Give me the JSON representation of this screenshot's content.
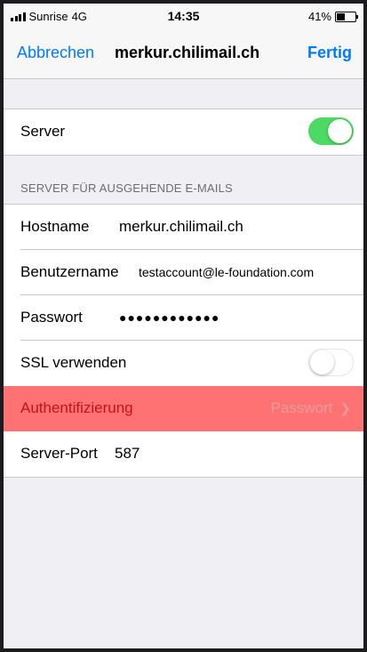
{
  "status_bar": {
    "carrier": "Sunrise",
    "network": "4G",
    "time": "14:35",
    "battery": "41%",
    "battery_level": 0.41
  },
  "nav": {
    "cancel_label": "Abbrechen",
    "title": "merkur.chilimail.ch",
    "done_label": "Fertig"
  },
  "server_row": {
    "label": "Server",
    "toggle_on": true
  },
  "outgoing_section": {
    "header": "SERVER FÜR AUSGEHENDE E-MAILS",
    "hostname": {
      "label": "Hostname",
      "value": "merkur.chilimail.ch"
    },
    "username": {
      "label": "Benutzername",
      "value": "testaccount@le-foundation.com"
    },
    "password": {
      "label": "Passwort",
      "value": "●●●●●●●●●●●●"
    },
    "ssl": {
      "label": "SSL verwenden",
      "toggle_on": false
    },
    "auth": {
      "label": "Authentifizierung",
      "value": "Passwort"
    },
    "port": {
      "label": "Server-Port",
      "value": "587"
    }
  },
  "colors": {
    "accent": "#007aff",
    "toggle_on": "#4cd964",
    "highlight": "#fe7273"
  }
}
